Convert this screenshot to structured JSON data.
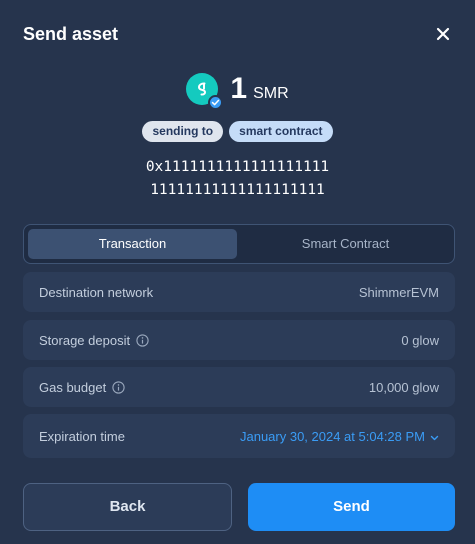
{
  "dialog": {
    "title": "Send asset",
    "close_icon": "close-icon"
  },
  "asset": {
    "icon": "shimmer-token-icon",
    "verified_icon": "verified-badge-icon",
    "amount": "1",
    "unit": "SMR"
  },
  "tags": {
    "sending_to": "sending to",
    "recipient_type": "smart contract"
  },
  "recipient": {
    "address_line1": "0x1111111111111111111",
    "address_line2": "11111111111111111111"
  },
  "tabs": [
    {
      "label": "Transaction",
      "active": true
    },
    {
      "label": "Smart Contract",
      "active": false
    }
  ],
  "details": {
    "destination_network": {
      "label": "Destination network",
      "value": "ShimmerEVM"
    },
    "storage_deposit": {
      "label": "Storage deposit",
      "value": "0 glow",
      "icon": "info-icon"
    },
    "gas_budget": {
      "label": "Gas budget",
      "value": "10,000 glow",
      "icon": "info-icon"
    },
    "expiration_time": {
      "label": "Expiration time",
      "value": "January 30, 2024 at 5:04:28 PM",
      "icon": "chevron-down-icon"
    }
  },
  "actions": {
    "back_label": "Back",
    "send_label": "Send"
  },
  "colors": {
    "background": "#26344d",
    "accent": "#1e8df5",
    "token": "#14cabf"
  }
}
